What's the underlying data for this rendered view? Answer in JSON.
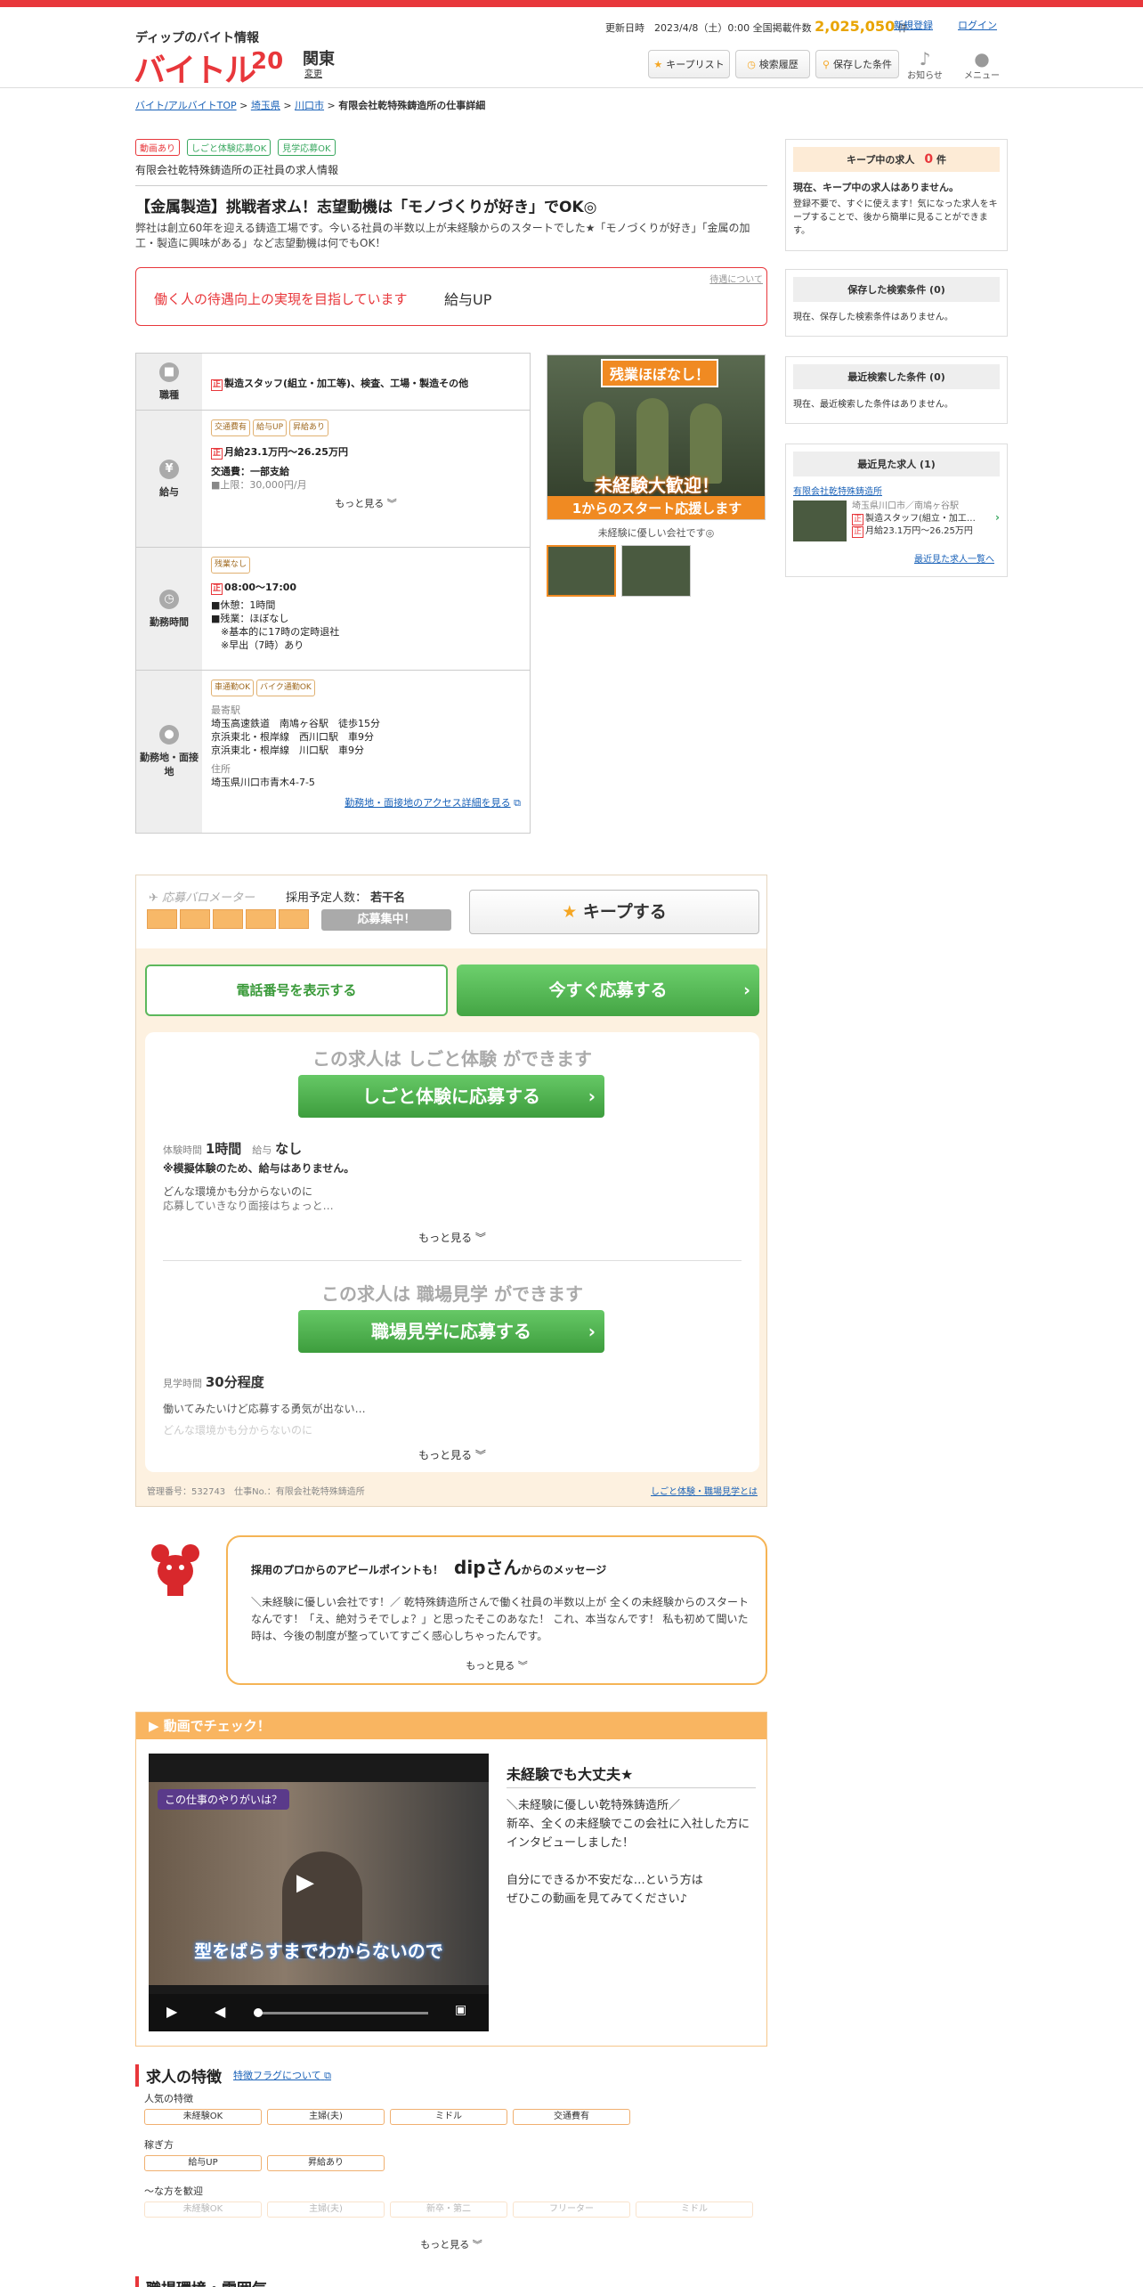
{
  "header": {
    "tagline": "ディップのバイト情報",
    "logo_text": "バイトル",
    "logo_20": "20",
    "region": "関東",
    "region_change": "変更",
    "updated_label": "更新日時　2023/4/8（土）0:00 全国掲載件数",
    "job_count": "2,025,050",
    "job_count_unit": "件",
    "register_link": "新規登録",
    "login_link": "ログイン",
    "keep_list": "キープリスト",
    "search_history": "検索履歴",
    "saved_conditions": "保存した条件",
    "notice": "お知らせ",
    "menu": "メニュー"
  },
  "breadcrumb": {
    "top": "バイト/アルバイトTOP",
    "pref": "埼玉県",
    "city": "川口市",
    "current": "有限会社乾特殊鋳造所の仕事詳細"
  },
  "tags": [
    "動画あり",
    "しごと体験応募OK",
    "見学応募OK"
  ],
  "company_line": "有限会社乾特殊鋳造所の正社員の求人情報",
  "job_title": "【金属製造】挑戦者求ム！志望動機は「モノづくりが好き」でOK◎",
  "job_desc": "弊社は創立60年を迎える鋳造工場です。今いる社員の半数以上が未経験からのスタートでした★「モノづくりが好き」「金属の加工・製造に興味がある」など志望動機は何でもOK！",
  "treatment": {
    "text": "働く人の待遇向上の実現を目指しています",
    "item": "給与UP",
    "about": "待遇について"
  },
  "info": {
    "job_type_label": "職種",
    "sei": "正",
    "job_type": "製造スタッフ(組立・加工等)、検査、工場・製造その他",
    "salary_label": "給与",
    "salary_tags": [
      "交通費有",
      "給与UP",
      "昇給あり"
    ],
    "salary": "月給23.1万円～26.25万円",
    "transport": "交通費：一部支給",
    "transport_cap": "■上限：30,000円/月",
    "more": "もっと見る",
    "time_label": "勤務時間",
    "time_tags": [
      "残業なし"
    ],
    "time": "08:00～17:00",
    "time_lines": [
      "■休憩：1時間",
      "■残業：ほぼなし",
      "　※基本的に17時の定時退社",
      "　※早出（7時）あり"
    ],
    "place_label": "勤務地・面接地",
    "place_tags": [
      "車通勤OK",
      "バイク通勤OK"
    ],
    "station_label": "最寄駅",
    "stations": [
      "埼玉高速鉄道　南鳩ヶ谷駅　徒歩15分",
      "京浜東北・根岸線　西川口駅　車9分",
      "京浜東北・根岸線　川口駅　車9分"
    ],
    "address_label": "住所",
    "address": "埼玉県川口市青木4-7-5",
    "access_link": "勤務地・面接地のアクセス詳細を見る"
  },
  "photo": {
    "banner_top": "残業ほぼなし！",
    "banner_bottom1": "未経験大歓迎！",
    "banner_bottom2": "1からのスタート応援します",
    "caption": "未経験に優しい会社です◎"
  },
  "sidebar": {
    "keep_title": "キープ中の求人",
    "keep_count": "0",
    "keep_unit": "件",
    "keep_none": "現在、キープ中の求人はありません。",
    "keep_text": "登録不要で、すぐに使えます！気になった求人をキープすることで、後から簡単に見ることができます。",
    "saved_title": "保存した検索条件 (0)",
    "saved_none": "現在、保存した検索条件はありません。",
    "recent_search_title": "最近検索した条件 (0)",
    "recent_search_none": "現在、最近検索した条件はありません。",
    "recent_view_title": "最近見た求人 (1)",
    "recent_company": "有限会社乾特殊鋳造所",
    "recent_place": "埼玉県川口市／南鳩ヶ谷駅",
    "recent_job": "製造スタッフ(組立・加工…",
    "recent_salary": "月給23.1万円～26.25万円",
    "recent_list_link": "最近見た求人一覧へ"
  },
  "apply": {
    "meter_label": "応募バロメーター",
    "meter_level": 5,
    "meter_max": 5,
    "hire_label": "採用予定人数：",
    "hire_value": "若干名",
    "recruiting": "応募集中！",
    "keep_btn": "キープする",
    "tel_btn": "電話番号を表示する",
    "apply_btn": "今すぐ応募する",
    "taiken_head": "この求人は しごと体験 ができます",
    "taiken_btn": "しごと体験に応募する",
    "taiken_time_label": "体験時間",
    "taiken_time": "1時間",
    "taiken_pay_label": "給与",
    "taiken_pay": "なし",
    "taiken_note": "※模擬体験のため、給与はありません。",
    "taiken_text1": "どんな環境かも分からないのに",
    "taiken_text2": "応募していきなり面接はちょっと…",
    "more": "もっと見る",
    "kengaku_head": "この求人は 職場見学 ができます",
    "kengaku_btn": "職場見学に応募する",
    "kengaku_time_label": "見学時間",
    "kengaku_time": "30分程度",
    "kengaku_text1": "働いてみたいけど応募する勇気が出ない…",
    "kengaku_text2": "どんな環境かも分からないのに",
    "manage_no": "管理番号：532743　仕事No.：有限会社乾特殊鋳造所",
    "about_link": "しごと体験・職場見学とは"
  },
  "message": {
    "head_pre": "採用のプロからのアピールポイントも！",
    "head_dip": "dipさん",
    "head_post": "からのメッセージ",
    "body": "＼未経験に優しい会社です！／ 乾特殊鋳造所さんで働く社員の半数以上が 全くの未経験からのスタートなんです！「え、絶対うそでしょ？」と思ったそこのあなた！ これ、本当なんです！ 私も初めて聞いた時は、今後の制度が整っていてすごく感心しちゃったんです。",
    "more": "もっと見る"
  },
  "video": {
    "section_title": "動画でチェック！",
    "caption_top": "この仕事のやりがいは？",
    "caption_sub": "型をばらすまでわからないので",
    "title": "未経験でも大丈夫★",
    "text": "＼未経験に優しい乾特殊鋳造所／\n新卒、全くの未経験でこの会社に入社した方にインタビューしました！\n\n自分にできるか不安だな…という方は\nぜひこの動画を見てみてください♪"
  },
  "features": {
    "title": "求人の特徴",
    "flag_link": "特徴フラグについて",
    "popular_label": "人気の特徴",
    "popular": [
      "未経験OK",
      "主婦(夫)",
      "ミドル",
      "交通費有"
    ],
    "earn_label": "稼ぎ方",
    "earn": [
      "給与UP",
      "昇給あり"
    ],
    "person_label": "～な方を歓迎",
    "person": [
      "未経験OK",
      "主婦(夫)",
      "新卒・第二",
      "フリーター",
      "ミドル"
    ],
    "more": "もっと見る"
  },
  "next_section": "職場環境・雰囲気",
  "colors": {
    "brand_red": "#e8373b",
    "accent_orange": "#f9b561",
    "green": "#44a544"
  }
}
